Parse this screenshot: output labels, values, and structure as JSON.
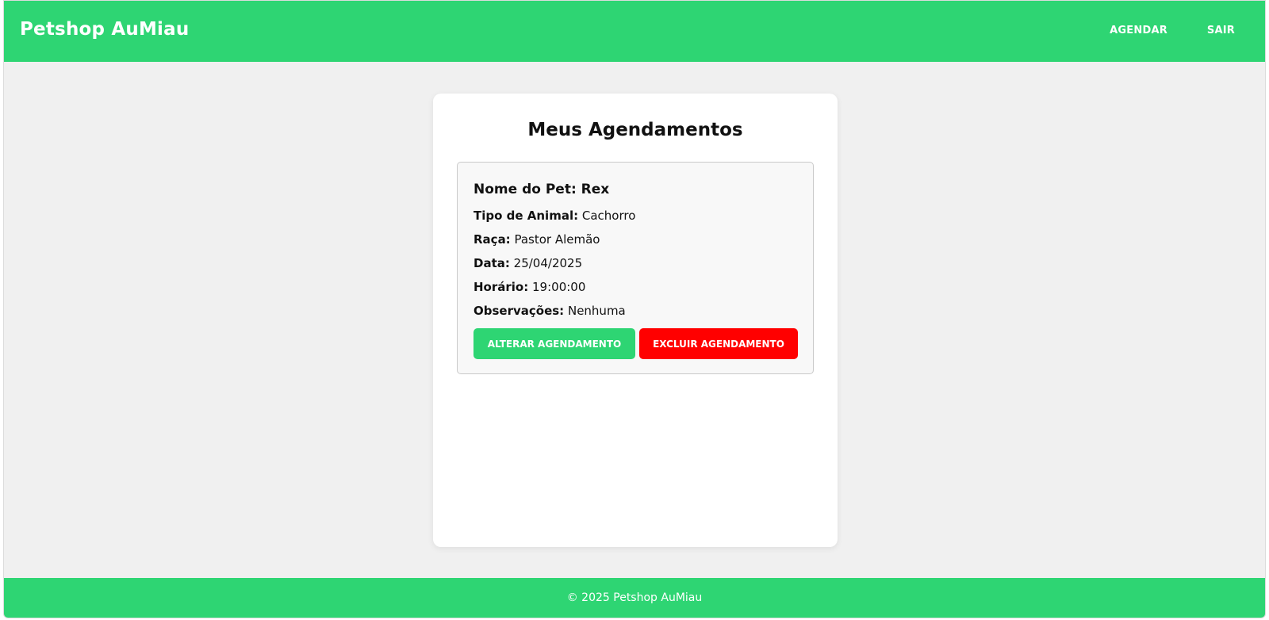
{
  "header": {
    "brand": "Petshop AuMiau",
    "nav": [
      {
        "label": "AGENDAR"
      },
      {
        "label": "SAIR"
      }
    ]
  },
  "main": {
    "title": "Meus Agendamentos",
    "appointments": [
      {
        "pet_name_label": "Nome do Pet:",
        "pet_name": "Rex",
        "fields": [
          {
            "label": "Tipo de Animal:",
            "value": "Cachorro"
          },
          {
            "label": "Raça:",
            "value": "Pastor Alemão"
          },
          {
            "label": "Data:",
            "value": "25/04/2025"
          },
          {
            "label": "Horário:",
            "value": "19:00:00"
          },
          {
            "label": "Observações:",
            "value": "Nenhuma"
          }
        ],
        "edit_label": "ALTERAR AGENDAMENTO",
        "delete_label": "EXCLUIR AGENDAMENTO"
      }
    ]
  },
  "footer": {
    "text": "© 2025 Petshop AuMiau"
  },
  "colors": {
    "brand_green": "#2ed573",
    "danger_red": "#ff0000",
    "page_bg": "#f0f0f0"
  }
}
